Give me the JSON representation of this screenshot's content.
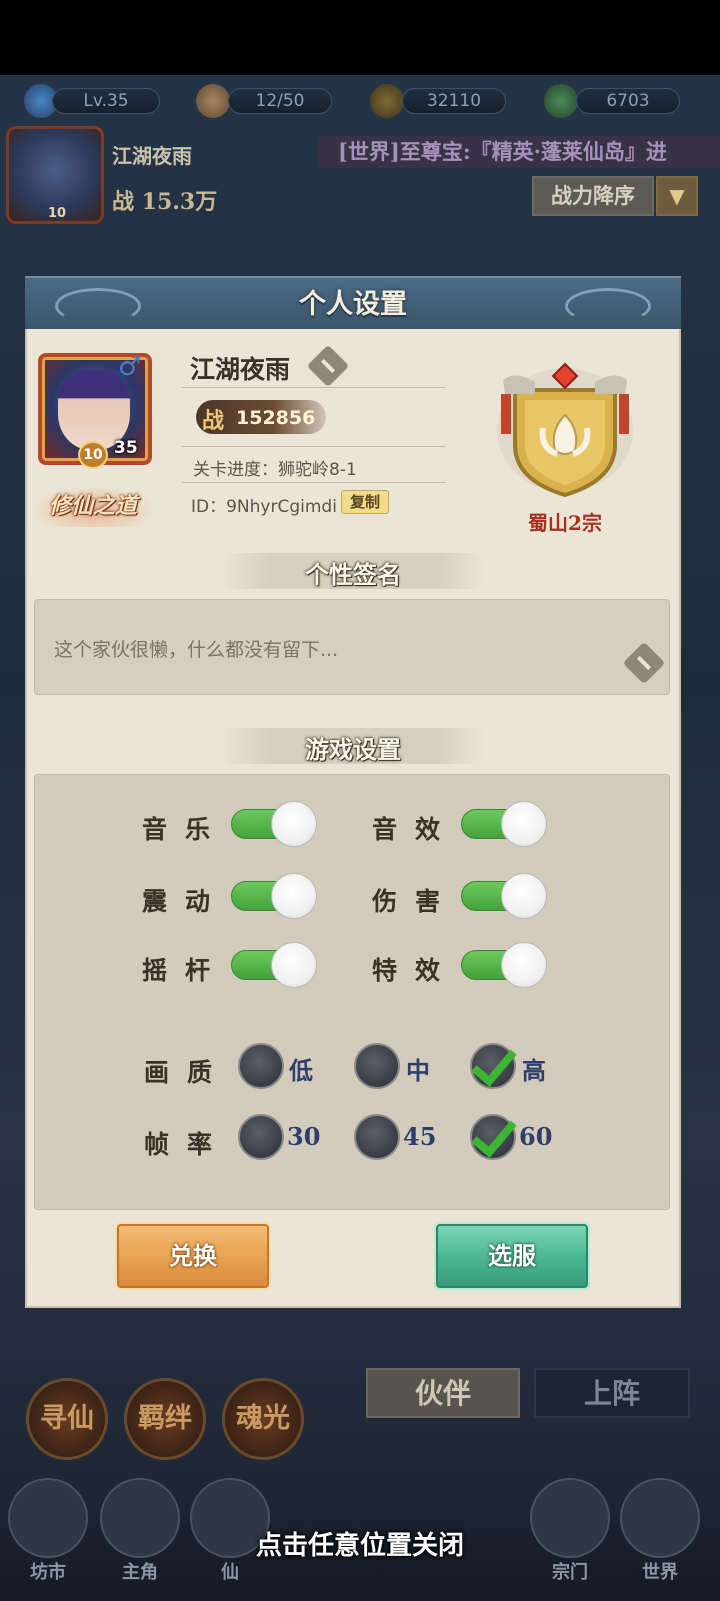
{
  "hud": {
    "level": "Lv.35",
    "stamina": "12/50",
    "coins": "32110",
    "jade": "6703",
    "player_name": "江湖夜雨",
    "power": "战 15.3万",
    "portrait_level": "10",
    "ticker": "[世界]至尊宝:『精英·蓬莱仙岛』进",
    "sort_label": "战力降序",
    "tabs": [
      "伙伴",
      "上阵"
    ],
    "circle_buttons": [
      "寻仙",
      "羁绊",
      "魂光"
    ],
    "nav": [
      "坊市",
      "主角",
      "仙",
      "宗门",
      "世界"
    ],
    "close_hint": "点击任意位置关闭"
  },
  "dialog": {
    "title": "个人设置",
    "profile": {
      "name": "江湖夜雨",
      "gender_icon": "male-icon",
      "level_badge": "10",
      "level": "35",
      "cultivation_badge": "修仙之道",
      "power_label": "战",
      "power_value": "152856",
      "stage": "关卡进度：狮驼岭8-1",
      "id": "ID：9NhyrCgimdi",
      "copy_label": "复制",
      "sect_name": "蜀山2宗"
    },
    "signature": {
      "header": "个性签名",
      "text": "这个家伙很懒，什么都没有留下..."
    },
    "game_settings": {
      "header": "游戏设置",
      "toggles": [
        {
          "label": "音乐",
          "on": true
        },
        {
          "label": "音效",
          "on": true
        },
        {
          "label": "震动",
          "on": true
        },
        {
          "label": "伤害",
          "on": true
        },
        {
          "label": "摇杆",
          "on": true
        },
        {
          "label": "特效",
          "on": true
        }
      ],
      "quality": {
        "label": "画质",
        "options": [
          "低",
          "中",
          "高"
        ],
        "selected": "高"
      },
      "framerate": {
        "label": "帧率",
        "options": [
          "30",
          "45",
          "60"
        ],
        "selected": "60"
      }
    },
    "buttons": {
      "exchange": "兑换",
      "outfit": "选服"
    }
  },
  "colors": {
    "toggle_on": "#4fb044",
    "check": "#3db534",
    "exchange_button": "#e8a454",
    "outfit_button": "#4cb893",
    "dialog_header": "#3f5b71"
  }
}
